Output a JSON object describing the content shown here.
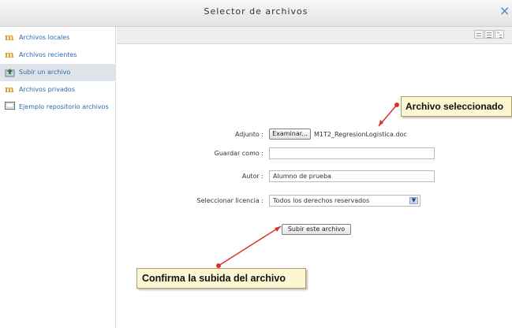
{
  "dialog": {
    "title": "Selector de archivos",
    "close_glyph": "×"
  },
  "sidebar": {
    "items": [
      {
        "label": "Archivos locales",
        "icon": "moodle-m-icon"
      },
      {
        "label": "Archivos recientes",
        "icon": "moodle-m-icon"
      },
      {
        "label": "Subir un archivo",
        "icon": "upload-icon",
        "active": true
      },
      {
        "label": "Archivos privados",
        "icon": "moodle-m-icon"
      },
      {
        "label": "Ejemplo repositorio archivos",
        "icon": "repository-icon"
      }
    ]
  },
  "form": {
    "attachment_label": "Adjunto :",
    "browse_button": "Examinar...",
    "selected_file": "M1T2_RegresionLogistica.doc",
    "save_as_label": "Guardar como :",
    "save_as_value": "",
    "author_label": "Autor :",
    "author_value": "Alumno de prueba",
    "license_label": "Seleccionar licencia :",
    "license_value": "Todos los derechos reservados",
    "upload_button": "Subir este archivo"
  },
  "annotations": {
    "file_selected": "Archivo seleccionado",
    "confirm_upload": "Confirma la subida del archivo"
  },
  "colors": {
    "accent": "#2c6aa8",
    "callout_bg": "#fdf6d3",
    "arrow": "#d8362a"
  }
}
